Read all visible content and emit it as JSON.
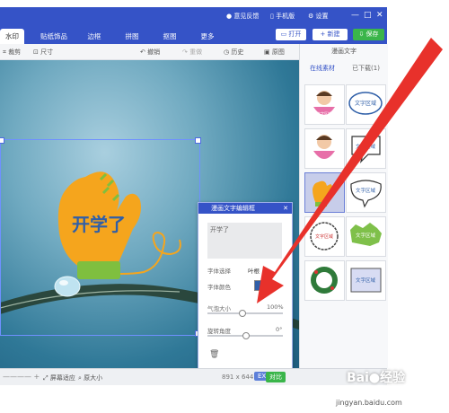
{
  "titlebar": {
    "feedback": "意见反馈",
    "mobile": "手机版",
    "settings": "设置",
    "minimize": "—",
    "maximize": "□",
    "close": "✕"
  },
  "tabs": [
    {
      "label": "水印"
    },
    {
      "label": "贴纸饰品"
    },
    {
      "label": "边框"
    },
    {
      "label": "拼图"
    },
    {
      "label": "抠图"
    },
    {
      "label": "更多"
    }
  ],
  "tab_buttons": {
    "open": "打开",
    "new": "新建",
    "save": "保存"
  },
  "toolbar": {
    "crop": "裁剪",
    "size": "尺寸",
    "undo": "撤销",
    "redo": "重做",
    "history": "历史",
    "original": "原图"
  },
  "right_panel": {
    "header": "漫画文字",
    "tab_online": "在线素材",
    "tab_downloaded": "已下载(1)"
  },
  "canvas": {
    "sticker_text": "开学了",
    "bubble_text": "文字区域"
  },
  "dialog": {
    "title": "漫画文字编辑框",
    "text_value": "开学了",
    "font_label": "字体选择",
    "font_value": "叶根",
    "color_label": "字体颜色",
    "bubble_size_label": "气泡大小",
    "bubble_size_value": "100%",
    "rotate_label": "旋转角度",
    "rotate_value": "0°",
    "delete_icon": "trash-icon",
    "bubble_size_level": 1.0,
    "rotate_level": 0.5
  },
  "statusbar": {
    "fit": "屏幕适应",
    "original_size": "原大小",
    "dimensions": "891 x 644",
    "exif": "EXIF",
    "compare": "对比"
  },
  "watermark": {
    "logo": "Bai&#9679;经验",
    "url": "jingyan.baidu.com"
  },
  "colors": {
    "brand": "#3553c7",
    "save_green": "#3ab54a",
    "arrow_red": "#e8312b",
    "sticker_orange": "#f5a51d",
    "text_blue": "#2f5fa8"
  }
}
